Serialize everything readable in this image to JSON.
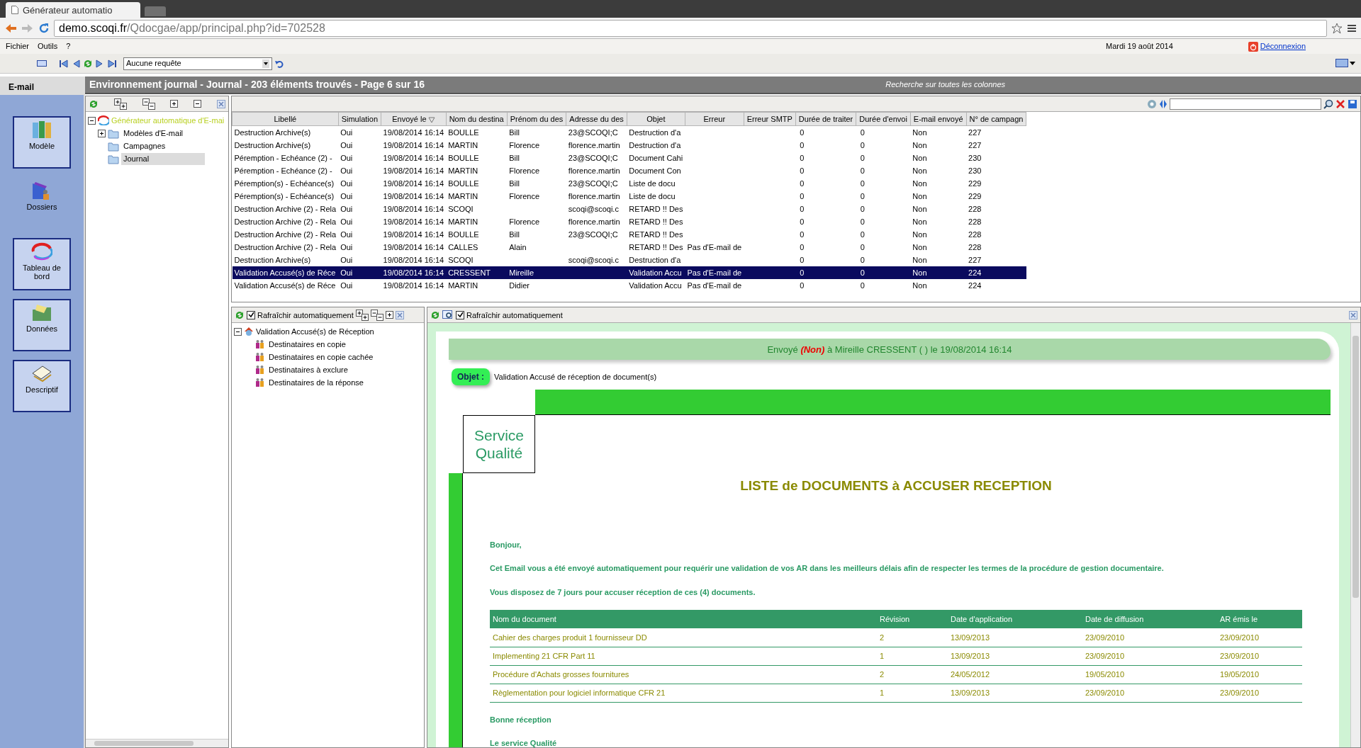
{
  "browser": {
    "tab_title": "Générateur automatio",
    "url_domain": "demo.scoqi.fr",
    "url_path": "/Qdocgae/app/principal.php?id=702528"
  },
  "menu": [
    "Fichier",
    "Outils",
    "?"
  ],
  "date": "Mardi 19 août 2014",
  "logout": "Déconnexion",
  "query_select": {
    "value": "Aucune requête"
  },
  "sidebar": {
    "title": "E-mail",
    "items": [
      {
        "label": "Modèle",
        "kind": "framed"
      },
      {
        "label": "Dossiers",
        "kind": "plain"
      },
      {
        "label": "Tableau de bord",
        "kind": "framed"
      },
      {
        "label": "Données",
        "kind": "framed"
      },
      {
        "label": "Descriptif",
        "kind": "framed"
      }
    ]
  },
  "title_bar": {
    "title": "Environnement journal - Journal - 203 éléments trouvés - Page 6 sur 16",
    "search_label": "Recherche sur toutes les colonnes"
  },
  "tree": {
    "label": "Générateur automatique d'E-mai",
    "expanded": true,
    "children": [
      {
        "label": "Modèles d'E-mail",
        "expanded": false,
        "selected": false
      },
      {
        "label": "Campagnes",
        "selected": false
      },
      {
        "label": "Journal",
        "selected": true
      }
    ]
  },
  "table": {
    "columns": [
      {
        "label": "Libellé",
        "sorted": false
      },
      {
        "label": "Simulation",
        "sorted": false
      },
      {
        "label": "Envoyé le",
        "sorted": true
      },
      {
        "label": "Nom du destina",
        "sorted": false
      },
      {
        "label": "Prénom du des",
        "sorted": false
      },
      {
        "label": "Adresse du des",
        "sorted": false
      },
      {
        "label": "Objet",
        "sorted": false
      },
      {
        "label": "Erreur",
        "sorted": false
      },
      {
        "label": "Erreur SMTP",
        "sorted": false
      },
      {
        "label": "Durée de traiter",
        "sorted": false
      },
      {
        "label": "Durée d'envoi",
        "sorted": false
      },
      {
        "label": "E-mail envoyé",
        "sorted": false
      },
      {
        "label": "N° de campagn",
        "sorted": false
      }
    ],
    "rows": [
      {
        "selected": false,
        "cells": [
          "Destruction Archive(s)",
          "Oui",
          "19/08/2014 16:14",
          "BOULLE",
          "Bill",
          "23@SCOQI;C",
          "Destruction d'a",
          "",
          "",
          "0",
          "0",
          "Non",
          "227"
        ]
      },
      {
        "selected": false,
        "cells": [
          "Destruction Archive(s)",
          "Oui",
          "19/08/2014 16:14",
          "MARTIN",
          "Florence",
          "florence.martin",
          "Destruction d'a",
          "",
          "",
          "0",
          "0",
          "Non",
          "227"
        ]
      },
      {
        "selected": false,
        "cells": [
          "Péremption - Echéance (2) -",
          "Oui",
          "19/08/2014 16:14",
          "BOULLE",
          "Bill",
          "23@SCOQI;C",
          "Document Cahi",
          "",
          "",
          "0",
          "0",
          "Non",
          "230"
        ]
      },
      {
        "selected": false,
        "cells": [
          "Péremption - Echéance (2) -",
          "Oui",
          "19/08/2014 16:14",
          "MARTIN",
          "Florence",
          "florence.martin",
          "Document Con",
          "",
          "",
          "0",
          "0",
          "Non",
          "230"
        ]
      },
      {
        "selected": false,
        "cells": [
          "Péremption(s) - Echéance(s)",
          "Oui",
          "19/08/2014 16:14",
          "BOULLE",
          "Bill",
          "23@SCOQI;C",
          "Liste de docu",
          "",
          "",
          "0",
          "0",
          "Non",
          "229"
        ]
      },
      {
        "selected": false,
        "cells": [
          "Péremption(s) - Echéance(s)",
          "Oui",
          "19/08/2014 16:14",
          "MARTIN",
          "Florence",
          "florence.martin",
          "Liste de docu",
          "",
          "",
          "0",
          "0",
          "Non",
          "229"
        ]
      },
      {
        "selected": false,
        "cells": [
          "Destruction Archive (2) - Rela",
          "Oui",
          "19/08/2014 16:14",
          "SCOQI",
          "",
          "scoqi@scoqi.c",
          "RETARD !! Des",
          "",
          "",
          "0",
          "0",
          "Non",
          "228"
        ]
      },
      {
        "selected": false,
        "cells": [
          "Destruction Archive (2) - Rela",
          "Oui",
          "19/08/2014 16:14",
          "MARTIN",
          "Florence",
          "florence.martin",
          "RETARD !! Des",
          "",
          "",
          "0",
          "0",
          "Non",
          "228"
        ]
      },
      {
        "selected": false,
        "cells": [
          "Destruction Archive (2) - Rela",
          "Oui",
          "19/08/2014 16:14",
          "BOULLE",
          "Bill",
          "23@SCOQI;C",
          "RETARD !! Des",
          "",
          "",
          "0",
          "0",
          "Non",
          "228"
        ]
      },
      {
        "selected": false,
        "cells": [
          "Destruction Archive (2) - Rela",
          "Oui",
          "19/08/2014 16:14",
          "CALLES",
          "Alain",
          "",
          "RETARD !! Des",
          "Pas d'E-mail de",
          "",
          "0",
          "0",
          "Non",
          "228"
        ]
      },
      {
        "selected": false,
        "cells": [
          "Destruction Archive(s)",
          "Oui",
          "19/08/2014 16:14",
          "SCOQI",
          "",
          "scoqi@scoqi.c",
          "Destruction d'a",
          "",
          "",
          "0",
          "0",
          "Non",
          "227"
        ]
      },
      {
        "selected": true,
        "cells": [
          "Validation Accusé(s) de Réce",
          "Oui",
          "19/08/2014 16:14",
          "CRESSENT",
          "Mireille",
          "",
          "Validation Accu",
          "Pas d'E-mail de",
          "",
          "0",
          "0",
          "Non",
          "224"
        ]
      },
      {
        "selected": false,
        "cells": [
          "Validation Accusé(s) de Réce",
          "Oui",
          "19/08/2014 16:14",
          "MARTIN",
          "Didier",
          "",
          "Validation Accu",
          "Pas d'E-mail de",
          "",
          "0",
          "0",
          "Non",
          "224"
        ]
      }
    ]
  },
  "detail_tree": {
    "auto_refresh": {
      "label": "Rafraîchir automatiquement",
      "checked": true
    },
    "label": "Validation Accusé(s) de Réception",
    "expanded": true,
    "children": [
      {
        "label": "Destinataires en copie"
      },
      {
        "label": "Destinataires en copie cachée"
      },
      {
        "label": "Destinataires à exclure"
      },
      {
        "label": "Destinataires de la réponse"
      }
    ]
  },
  "email": {
    "auto_refresh": {
      "label": "Rafraîchir automatiquement",
      "checked": true
    },
    "sent_prefix": "Envoyé",
    "status": "(Non)",
    "sent_suffix": "à Mireille CRESSENT ( ) le 19/08/2014 16:14",
    "subject_label": "Objet :",
    "subject": "Validation Accusé de réception de document(s)",
    "service": "Service Qualité",
    "heading": "LISTE de DOCUMENTS à ACCUSER RECEPTION",
    "paragraphs": [
      "Bonjour,",
      "Cet Email vous a été envoyé automatiquement pour requérir une validation de vos AR dans les meilleurs délais afin de respecter les termes de la procédure de gestion documentaire.",
      "Vous disposez de 7 jours pour accuser réception de ces (4) documents."
    ],
    "doc_table": {
      "columns": [
        "Nom du document",
        "Révision",
        "Date d'application",
        "Date de diffusion",
        "AR émis le"
      ],
      "rows": [
        [
          "Cahier des charges produit 1 fournisseur DD",
          "2",
          "13/09/2013",
          "23/09/2010",
          "23/09/2010"
        ],
        [
          "Implementing 21 CFR Part 11",
          "1",
          "13/09/2013",
          "23/09/2010",
          "23/09/2010"
        ],
        [
          "Procédure d'Achats grosses fournitures",
          "2",
          "24/05/2012",
          "19/05/2010",
          "19/05/2010"
        ],
        [
          "Règlementation pour logiciel informatique CFR 21",
          "1",
          "13/09/2013",
          "23/09/2010",
          "23/09/2010"
        ]
      ]
    },
    "closing": [
      "Bonne réception",
      "Le service Qualité"
    ]
  }
}
